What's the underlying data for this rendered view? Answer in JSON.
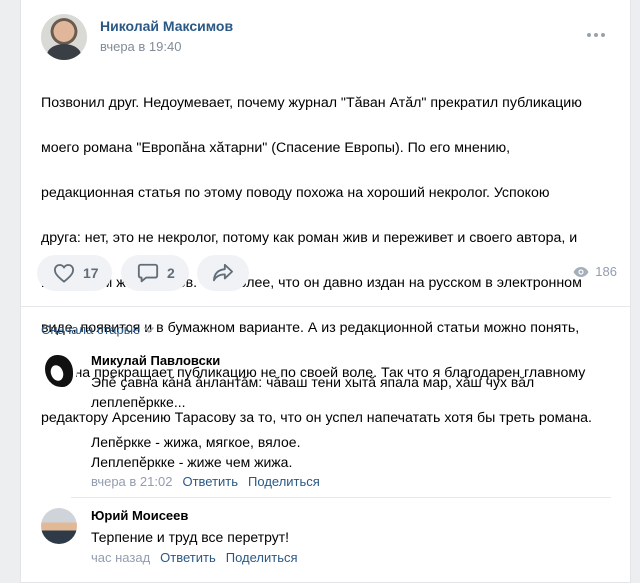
{
  "post": {
    "author": "Николай Максимов",
    "time": "вчера в 19:40",
    "text_lines": [
      "Позвонил друг. Недоумевает, почему журнал \"Тӑван Атӑл\" прекратил публикацию",
      "моего романа \"Европӑна хӑтарни\" (Спасение Европы). По его мнению,",
      "редакционная статья по этому поводу похожа на хороший некролог. Успокою",
      "друга: нет, это не некролог, потому как роман жив и переживет и своего автора, и",
      "всяких там женсоветов. Тем более, что он давно издан на русском в электронном",
      "виде, появится и в бумажном варианте. А из редакционной статьи можно понять,",
      "что она прекращает публикацию не по своей воле. Так что я благодарен главному",
      "редактору Арсению Тарасову за то, что он успел напечатать хотя бы треть романа."
    ],
    "likes": "17",
    "comments": "2",
    "views": "186"
  },
  "sort": {
    "label": "Сначала старые"
  },
  "comments": [
    {
      "author": "Микулай Павловски",
      "lines": [
        "Эпӗ ҫавна кӑна ӑнлантӑм: чӑваш тени хытӑ япала мар, хӑш чух вӑл",
        "леплепӗркке...",
        "",
        "Лепӗркке - жижа, мягкое, вялое.",
        "Леплепӗркке - жиже чем жижа."
      ],
      "time": "вчера в 21:02",
      "reply": "Ответить",
      "share": "Поделиться"
    },
    {
      "author": "Юрий Моисеев",
      "lines": [
        "Терпение и труд все перетрут!"
      ],
      "time": "час назад",
      "reply": "Ответить",
      "share": "Поделиться"
    }
  ],
  "colors": {
    "link": "#2a5885",
    "muted": "#818c99",
    "bg": "#edeef0"
  },
  "icons": [
    "more-icon",
    "heart-icon",
    "comment-icon",
    "share-icon",
    "eye-icon",
    "chevron-down-icon"
  ]
}
